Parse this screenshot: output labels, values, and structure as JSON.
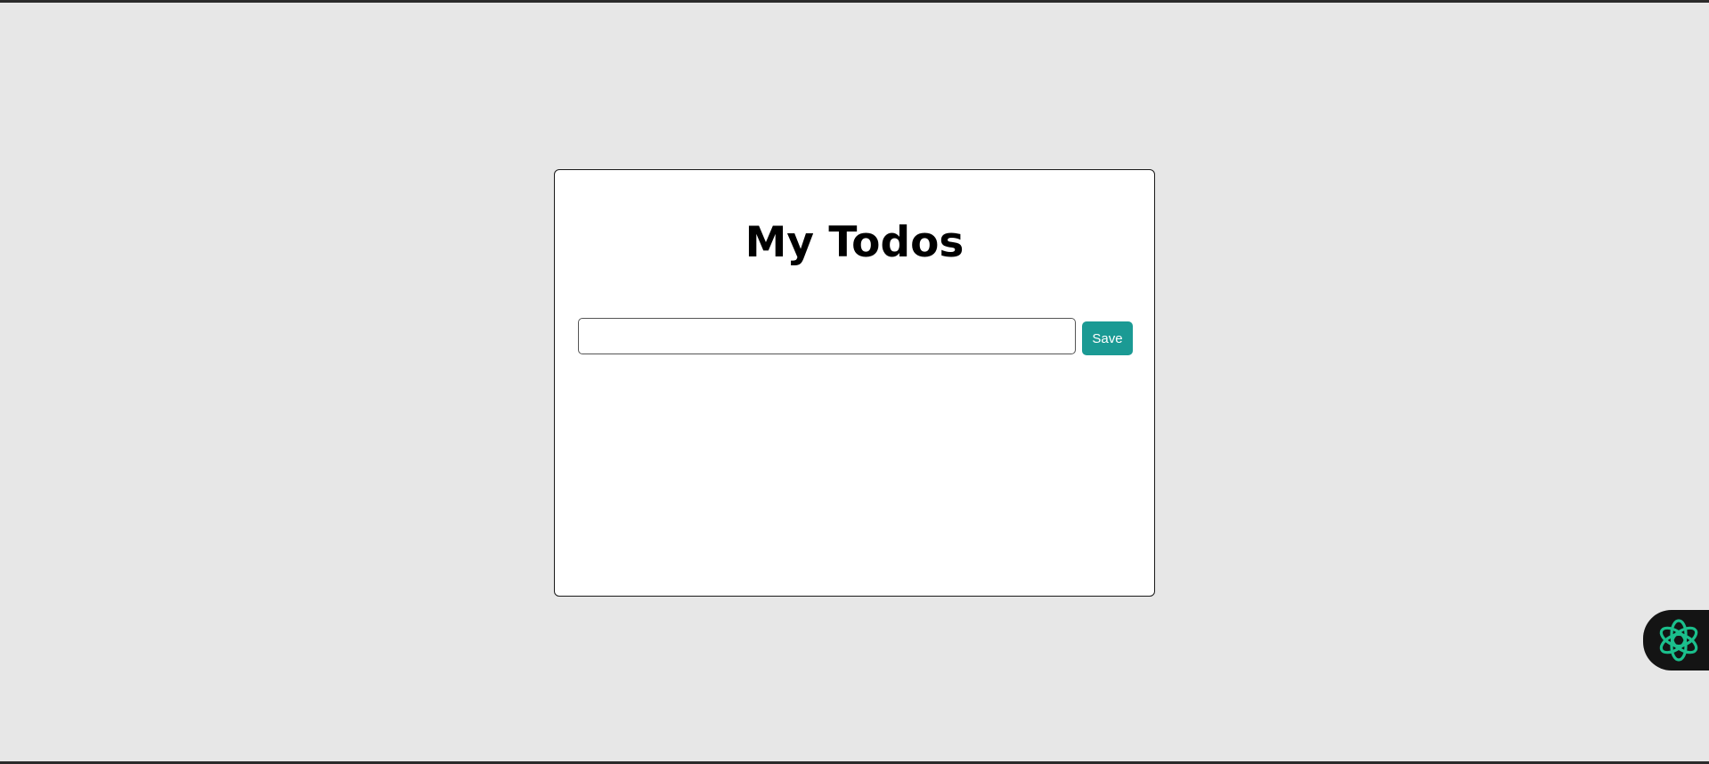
{
  "page": {
    "title": "My Todos"
  },
  "form": {
    "input_value": "",
    "input_placeholder": "",
    "save_label": "Save"
  },
  "assistant": {
    "icon": "openai-knot-icon"
  },
  "colors": {
    "background": "#e7e7e7",
    "card": "#ffffff",
    "accent": "#1b9a94",
    "assistant_bg": "#141414",
    "assistant_icon": "#1bbf8c"
  }
}
